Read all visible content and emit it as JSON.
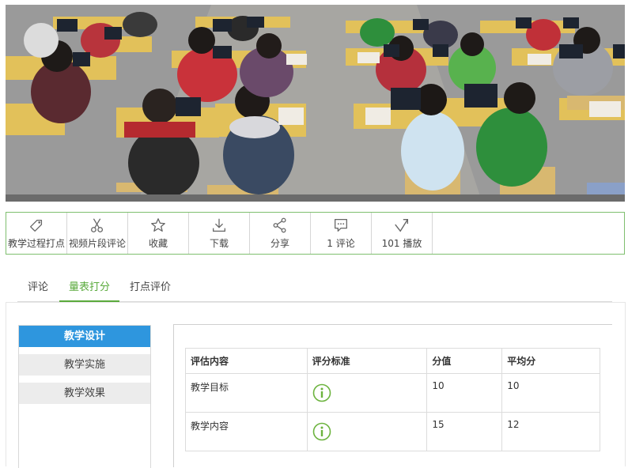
{
  "toolbar": {
    "items": [
      {
        "label": "教学过程打点",
        "icon": "tag-icon"
      },
      {
        "label": "视频片段评论",
        "icon": "scissors-icon"
      },
      {
        "label": "收藏",
        "icon": "star-icon"
      },
      {
        "label": "下载",
        "icon": "download-icon"
      },
      {
        "label": "分享",
        "icon": "share-icon"
      },
      {
        "label": "1 评论",
        "icon": "comment-icon"
      },
      {
        "label": "101 播放",
        "icon": "play-count-icon"
      }
    ]
  },
  "tabs": [
    {
      "label": "评论",
      "active": false
    },
    {
      "label": "量表打分",
      "active": true
    },
    {
      "label": "打点评价",
      "active": false
    }
  ],
  "sidebar": {
    "items": [
      {
        "label": "教学设计",
        "active": true
      },
      {
        "label": "教学实施",
        "active": false
      },
      {
        "label": "教学效果",
        "active": false
      }
    ]
  },
  "table": {
    "headers": [
      "评估内容",
      "评分标准",
      "分值",
      "平均分"
    ],
    "rows": [
      {
        "content": "教学目标",
        "standard_icon": "info-icon",
        "score": "10",
        "average": "10"
      },
      {
        "content": "教学内容",
        "standard_icon": "info-icon",
        "score": "15",
        "average": "12"
      }
    ]
  },
  "colors": {
    "accent_green": "#5aaa3c",
    "sidebar_active": "#2e96de",
    "toolbar_border": "#7fbf6f"
  }
}
